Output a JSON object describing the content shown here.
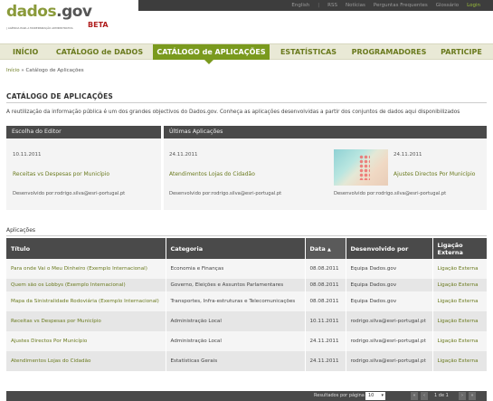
{
  "topbar": {
    "items": [
      "English",
      "|",
      "RSS",
      "Notícias",
      "Perguntas Frequentes",
      "Glossário",
      "Login"
    ]
  },
  "logo": {
    "main": "dados",
    "tld": ".gov",
    "beta": "BETA",
    "subtitle": "| AGÊNCIA PARA A MODERNIZAÇÃO ADMINISTRATIVA"
  },
  "nav": {
    "items": [
      "INÍCIO",
      "CATÁLOGO de DADOS",
      "CATÁLOGO de APLICAÇÕES",
      "ESTATÍSTICAS",
      "PROGRAMADORES",
      "PARTICIPE"
    ],
    "active_index": 2
  },
  "breadcrumb": {
    "home": "Início",
    "separator": "»",
    "current": "Catálogo de Aplicações"
  },
  "page": {
    "title": "CATÁLOGO DE APLICAÇÕES",
    "intro": "A reutilização da informação pública é um dos grandes objectivos do Dados.gov. Conheça as aplicações desenvolvidas a partir dos conjuntos de dados aqui disponibilizados"
  },
  "editor_choice": {
    "heading": "Escolha do Editor",
    "date": "10.11.2011",
    "title": "Receitas vs Despesas por Município",
    "developer": "Desenvolvido por:rodrigo.silva@esri-portugal.pt"
  },
  "latest": {
    "heading": "Últimas Aplicações",
    "items": [
      {
        "date": "24.11.2011",
        "title": "Atendimentos Lojas do Cidadão",
        "developer": "Desenvolvido por:rodrigo.silva@esri-portugal.pt"
      },
      {
        "date": "24.11.2011",
        "title": "Ajustes Directos Por Município",
        "developer": "Desenvolvido por:rodrigo.silva@esri-portugal.pt"
      }
    ]
  },
  "applications": {
    "label": "Aplicações",
    "columns": [
      "Título",
      "Categoria",
      "Data",
      "▲",
      "Desenvolvido por",
      "Ligação Externa"
    ],
    "rows": [
      {
        "title": "Para onde Vai o Meu Dinheiro (Exemplo Internacional)",
        "category": "Economia e Finanças",
        "date": "08.08.2011",
        "developer": "Equipa Dados.gov",
        "link": "Ligação Externa"
      },
      {
        "title": "Quem são os Lobbys (Exemplo Internacional)",
        "category": "Governo, Eleições e Assuntos Parlamentares",
        "date": "08.08.2011",
        "developer": "Equipa Dados.gov",
        "link": "Ligação Externa"
      },
      {
        "title": "Mapa da Sinistralidade Rodoviária (Exemplo Internacional)",
        "category": "Transportes, Infra-estruturas e Telecomunicações",
        "date": "08.08.2011",
        "developer": "Equipa Dados.gov",
        "link": "Ligação Externa"
      },
      {
        "title": "Receitas vs Despesas por Município",
        "category": "Administração Local",
        "date": "10.11.2011",
        "developer": "rodrigo.silva@esri-portugal.pt",
        "link": "Ligação Externa"
      },
      {
        "title": "Ajustes Directos Por Município",
        "category": "Administração Local",
        "date": "24.11.2011",
        "developer": "rodrigo.silva@esri-portugal.pt",
        "link": "Ligação Externa"
      },
      {
        "title": "Atendimentos Lojas do Cidadão",
        "category": "Estatísticas Gerais",
        "date": "24.11.2011",
        "developer": "rodrigo.silva@esri-portugal.pt",
        "link": "Ligação Externa"
      }
    ]
  },
  "pager": {
    "label": "Resultados por página",
    "per_page": "10",
    "status": "1 de 1",
    "first": "«",
    "prev": "‹",
    "next": "›",
    "last": "»"
  }
}
